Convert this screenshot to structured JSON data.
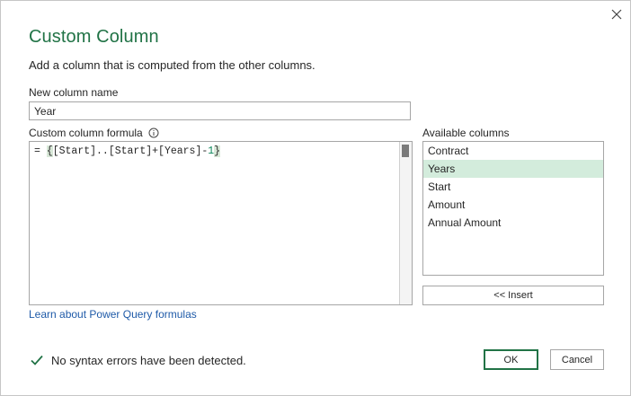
{
  "dialog": {
    "title": "Custom Column",
    "subtitle": "Add a column that is computed from the other columns.",
    "close_icon": "close-icon"
  },
  "name_field": {
    "label": "New column name",
    "value": "Year"
  },
  "formula": {
    "label": "Custom column formula",
    "info_icon": "info-circle-icon",
    "prefix": "= ",
    "open_brace": "{",
    "body": "[Start]..[Start]+[Years]-",
    "number": "1",
    "close_brace": "}"
  },
  "available_columns": {
    "label": "Available columns",
    "items": [
      "Contract",
      "Years",
      "Start",
      "Amount",
      "Annual Amount"
    ],
    "selected": "Years",
    "insert_label": "<< Insert"
  },
  "learn_link": "Learn about Power Query formulas",
  "status": {
    "icon": "checkmark-icon",
    "text": "No syntax errors have been detected."
  },
  "buttons": {
    "ok_label": "OK",
    "cancel_label": "Cancel"
  },
  "colors": {
    "accent": "#217346",
    "link": "#1e5aa8",
    "selection": "#d3ecdc"
  }
}
